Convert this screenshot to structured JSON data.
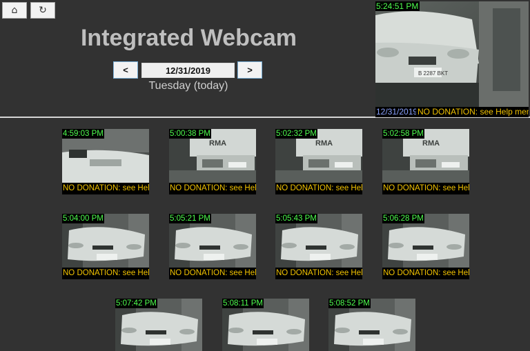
{
  "header": {
    "home_icon": "⌂",
    "refresh_icon": "↻",
    "title": "Integrated Webcam",
    "prev_label": "<",
    "next_label": ">",
    "date_value": "12/31/2019",
    "day_label": "Tuesday (today)"
  },
  "live": {
    "time": "5:24:51 PM",
    "date": "12/31/2019",
    "notice": "NO DONATION: see Help menu"
  },
  "thumbnails": [
    {
      "time": "4:59:03 PM",
      "notice": "NO DONATION: see Hel",
      "scene": "car-close"
    },
    {
      "time": "5:00:38 PM",
      "notice": "NO DONATION: see Hel",
      "scene": "truck"
    },
    {
      "time": "5:02:32 PM",
      "notice": "NO DONATION: see Hel",
      "scene": "truck"
    },
    {
      "time": "5:02:58 PM",
      "notice": "NO DONATION: see Hel",
      "scene": "truck"
    },
    {
      "time": "5:04:00 PM",
      "notice": "NO DONATION: see Hel",
      "scene": "car"
    },
    {
      "time": "5:05:21 PM",
      "notice": "NO DONATION: see Hel",
      "scene": "car"
    },
    {
      "time": "5:05:43 PM",
      "notice": "NO DONATION: see Hel",
      "scene": "car"
    },
    {
      "time": "5:06:28 PM",
      "notice": "NO DONATION: see Hel",
      "scene": "car"
    },
    {
      "time": "5:07:42 PM",
      "notice": "",
      "scene": "car"
    },
    {
      "time": "5:08:11 PM",
      "notice": "",
      "scene": "car"
    },
    {
      "time": "5:08:52 PM",
      "notice": "",
      "scene": "car"
    }
  ],
  "colors": {
    "background": "#323232",
    "timestamp": "#4fff4f",
    "notice": "#f2c300",
    "date": "#8aa2ff"
  }
}
